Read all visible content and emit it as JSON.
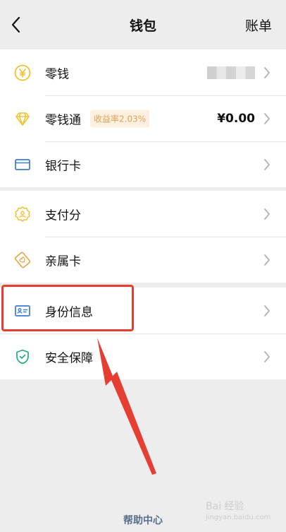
{
  "header": {
    "title": "钱包",
    "bill_label": "账单"
  },
  "groups": [
    {
      "items": [
        {
          "label": "零钱",
          "icon": "yuan-coin-icon",
          "value_hidden": true
        },
        {
          "label": "零钱通",
          "icon": "diamond-icon",
          "badge": "收益率2.03%",
          "amount": "¥0.00"
        },
        {
          "label": "银行卡",
          "icon": "bank-card-icon"
        }
      ]
    },
    {
      "items": [
        {
          "label": "支付分",
          "icon": "pay-score-icon"
        },
        {
          "label": "亲属卡",
          "icon": "family-card-icon"
        }
      ]
    },
    {
      "items": [
        {
          "label": "身份信息",
          "icon": "id-card-icon"
        },
        {
          "label": "安全保障",
          "icon": "shield-icon"
        }
      ]
    }
  ],
  "footer": {
    "help_label": "帮助中心"
  },
  "colors": {
    "accent_yellow": "#f1c232",
    "blue_icon": "#3a7bd5",
    "green_icon": "#1fae7a",
    "annotation_red": "#e53f33",
    "help_link": "#5a6e8e"
  },
  "watermark": {
    "text": "Bai 经验",
    "domain": "jingyan.baidu.com"
  }
}
